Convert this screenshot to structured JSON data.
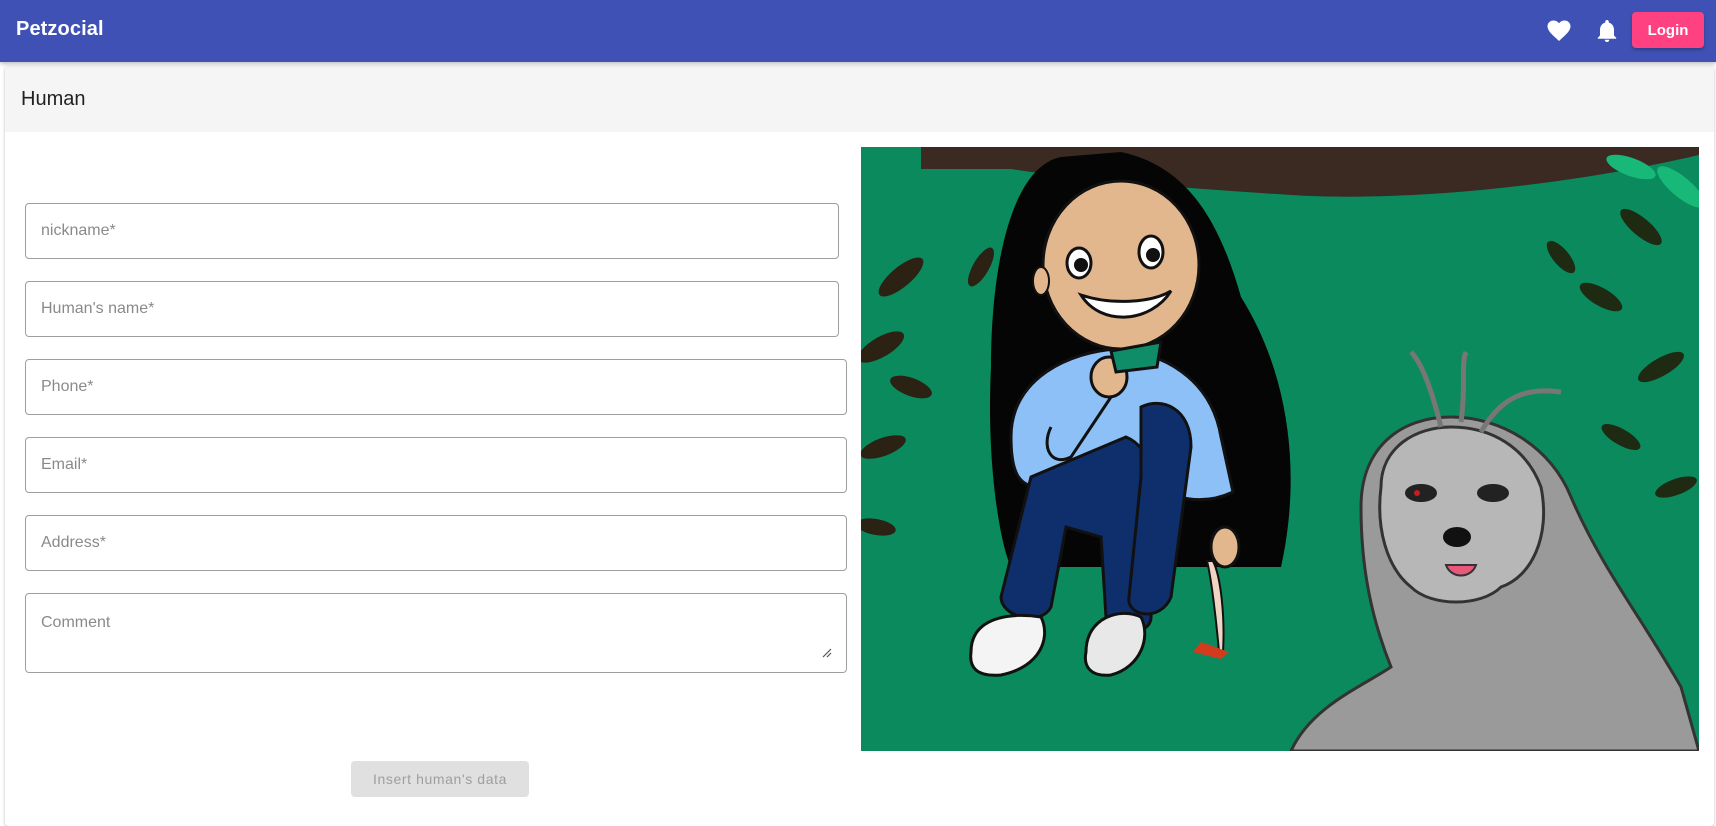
{
  "app": {
    "brand": "Petzocial"
  },
  "toolbar": {
    "favorites_icon": "heart-icon",
    "notifications_icon": "bell-icon",
    "login_label": "Login",
    "login_color": "#ff4081",
    "bar_color": "#3f51b5"
  },
  "card": {
    "title": "Human"
  },
  "form": {
    "nickname_placeholder": "nickname*",
    "name_placeholder": "Human's name*",
    "phone_placeholder": "Phone*",
    "email_placeholder": "Email*",
    "address_placeholder": "Address*",
    "comment_placeholder": "Comment",
    "submit_label": "Insert human's data"
  }
}
